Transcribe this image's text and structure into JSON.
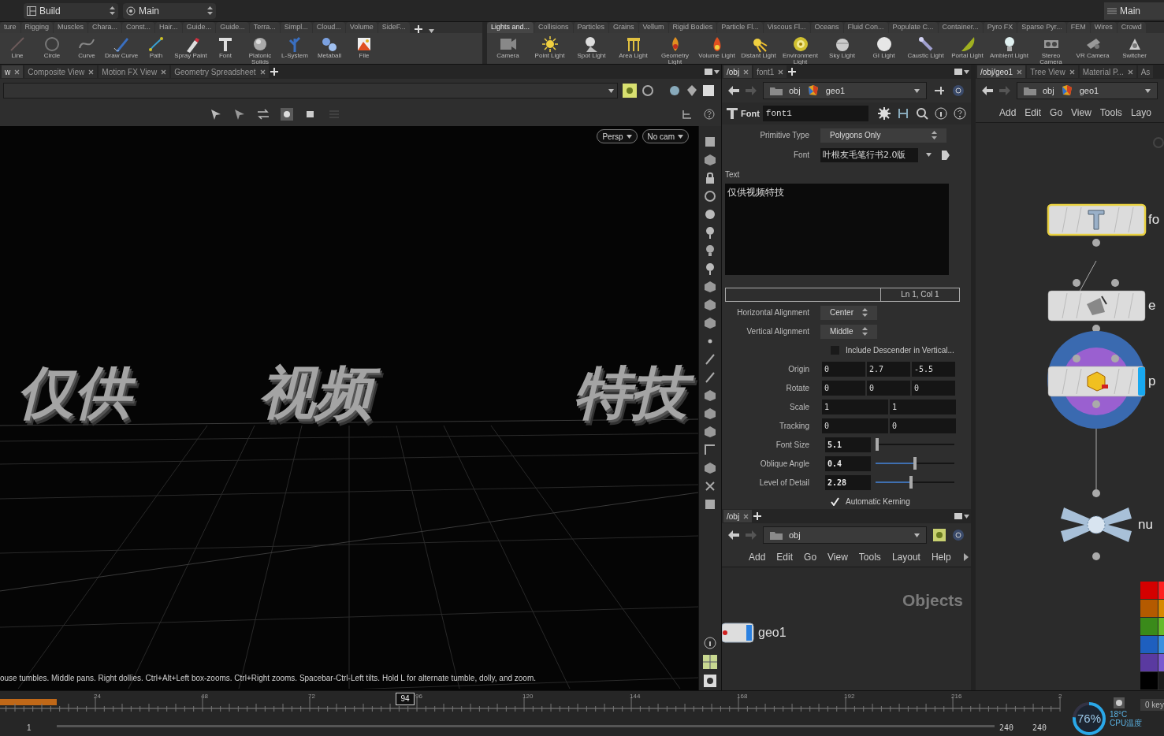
{
  "top_bar": {
    "layout": "Build",
    "desktop": "Main",
    "right_desktop": "Main"
  },
  "shelf_left": {
    "tabs": [
      {
        "label": "ture",
        "selected": false
      },
      {
        "label": "Rigging",
        "selected": false
      },
      {
        "label": "Muscles",
        "selected": false
      },
      {
        "label": "Chara...",
        "selected": false
      },
      {
        "label": "Const...",
        "selected": false
      },
      {
        "label": "Hair...",
        "selected": false
      },
      {
        "label": "Guide...",
        "selected": false
      },
      {
        "label": "Guide...",
        "selected": false
      },
      {
        "label": "Terra...",
        "selected": false
      },
      {
        "label": "Simpl...",
        "selected": false
      },
      {
        "label": "Cloud...",
        "selected": false
      },
      {
        "label": "Volume",
        "selected": false
      },
      {
        "label": "SideF...",
        "selected": false
      }
    ],
    "tools": [
      "Line",
      "Circle",
      "Curve",
      "Draw Curve",
      "Path",
      "Spray Paint",
      "Font",
      "Platonic Solids",
      "L-System",
      "Metaball",
      "File"
    ]
  },
  "shelf_right": {
    "tabs": [
      {
        "label": "Lights and...",
        "selected": true
      },
      {
        "label": "Collisions",
        "selected": false
      },
      {
        "label": "Particles",
        "selected": false
      },
      {
        "label": "Grains",
        "selected": false
      },
      {
        "label": "Vellum",
        "selected": false
      },
      {
        "label": "Rigid Bodies",
        "selected": false
      },
      {
        "label": "Particle Fl...",
        "selected": false
      },
      {
        "label": "Viscous Fl...",
        "selected": false
      },
      {
        "label": "Oceans",
        "selected": false
      },
      {
        "label": "Fluid Con...",
        "selected": false
      },
      {
        "label": "Populate C...",
        "selected": false
      },
      {
        "label": "Container...",
        "selected": false
      },
      {
        "label": "Pyro FX",
        "selected": false
      },
      {
        "label": "Sparse Pyr...",
        "selected": false
      },
      {
        "label": "FEM",
        "selected": false
      },
      {
        "label": "Wires",
        "selected": false
      },
      {
        "label": "Crowd",
        "selected": false
      }
    ],
    "tools": [
      "Camera",
      "Point Light",
      "Spot Light",
      "Area Light",
      "Geometry Light",
      "Volume Light",
      "Distant Light",
      "Environment Light",
      "Sky Light",
      "GI Light",
      "Caustic Light",
      "Portal Light",
      "Ambient Light",
      "Stereo Camera",
      "VR Camera",
      "Switcher"
    ]
  },
  "viewport": {
    "tabs": [
      {
        "label": "w",
        "selected": true
      },
      {
        "label": "Composite View",
        "selected": false
      },
      {
        "label": "Motion FX View",
        "selected": false
      },
      {
        "label": "Geometry Spreadsheet",
        "selected": false
      }
    ],
    "camera_menus": [
      "Persp",
      "No cam"
    ],
    "scene_text": [
      "仅供",
      "视频",
      "特技"
    ],
    "status": "ouse tumbles. Middle pans. Right dollies. Ctrl+Alt+Left box-zooms. Ctrl+Right zooms. Spacebar-Ctrl-Left tilts. Hold L for alternate tumble, dolly, and zoom."
  },
  "parameters": {
    "tabs": [
      {
        "label": "/obj",
        "selected": true
      },
      {
        "label": "font1",
        "selected": false
      }
    ],
    "path": [
      "obj",
      "geo1"
    ],
    "node_type": "Font",
    "node_name": "font1",
    "rows": [
      {
        "kind": "menu",
        "label": "Primitive Type",
        "value": "Polygons Only"
      },
      {
        "kind": "font",
        "label": "Font",
        "value": "叶根友毛笔行书2.0版"
      },
      {
        "kind": "text",
        "label": "Text",
        "value": "仅供视频特技",
        "cursor": "Ln 1, Col 1"
      },
      {
        "kind": "menu",
        "label": "Horizontal Alignment",
        "value": "Center"
      },
      {
        "kind": "menu",
        "label": "Vertical Alignment",
        "value": "Middle"
      },
      {
        "kind": "checkbox",
        "label": "Include Descender in Vertical...",
        "checked": false
      },
      {
        "kind": "vector",
        "label": "Origin",
        "values": [
          "0",
          "2.7",
          "-5.5"
        ]
      },
      {
        "kind": "vector",
        "label": "Rotate",
        "values": [
          "0",
          "0",
          "0"
        ]
      },
      {
        "kind": "vector",
        "label": "Scale",
        "values": [
          "1",
          "1"
        ]
      },
      {
        "kind": "vector",
        "label": "Tracking",
        "values": [
          "0",
          "0"
        ]
      },
      {
        "kind": "slider",
        "label": "Font Size",
        "value": "5.1",
        "level": 0.02
      },
      {
        "kind": "slider",
        "label": "Oblique Angle",
        "value": "0.4",
        "level": 0.5
      },
      {
        "kind": "slider",
        "label": "Level of Detail",
        "value": "2.28",
        "level": 0.45
      },
      {
        "kind": "checkbox",
        "label": "Automatic Kerning",
        "checked": true
      }
    ]
  },
  "object_network": {
    "tabs": [
      {
        "label": "/obj",
        "selected": true
      }
    ],
    "path": [
      "obj"
    ],
    "menu": [
      "Add",
      "Edit",
      "Go",
      "View",
      "Tools",
      "Layout",
      "Help"
    ],
    "context_label": "Objects",
    "nodes": [
      {
        "label": "geo1"
      }
    ]
  },
  "geometry_network": {
    "tabs": [
      {
        "label": "/obj/geo1",
        "selected": true
      },
      {
        "label": "Tree View",
        "selected": false
      },
      {
        "label": "Material P...",
        "selected": false
      },
      {
        "label": "As",
        "selected": false
      }
    ],
    "path": [
      "obj",
      "geo1"
    ],
    "menu": [
      "Add",
      "Edit",
      "Go",
      "View",
      "Tools",
      "Layo"
    ],
    "nodes": [
      {
        "kind": "font",
        "label": "fo",
        "selected": true
      },
      {
        "kind": "edit",
        "label": "e",
        "selected": false
      },
      {
        "kind": "extrude",
        "label": "p",
        "selected": false
      },
      {
        "kind": "null",
        "label": "nu",
        "selected": false
      }
    ],
    "palette": [
      {
        "color": "#d40000"
      },
      {
        "color": "#ff2020"
      },
      {
        "color": "#b45a00"
      },
      {
        "color": "#d88a00"
      },
      {
        "color": "#3a8a1a"
      },
      {
        "color": "#66bb2a"
      },
      {
        "color": "#1e5fbf"
      },
      {
        "color": "#3a90e0"
      },
      {
        "color": "#5a3aa0"
      },
      {
        "color": "#7a5ad0"
      },
      {
        "color": "#000000"
      },
      {
        "color": "#1c1c1c"
      }
    ]
  },
  "timeline": {
    "ticks": [
      "24",
      "48",
      "72",
      "96",
      "120",
      "144",
      "168",
      "192",
      "216",
      "2"
    ],
    "current_frame": "94",
    "start": "1",
    "end": "240",
    "end_field": "240",
    "keys": "0 key"
  },
  "cpu_widget": {
    "percent": "76%",
    "level": 0.76,
    "temperature": "18°C",
    "caption": "CPU温度"
  }
}
